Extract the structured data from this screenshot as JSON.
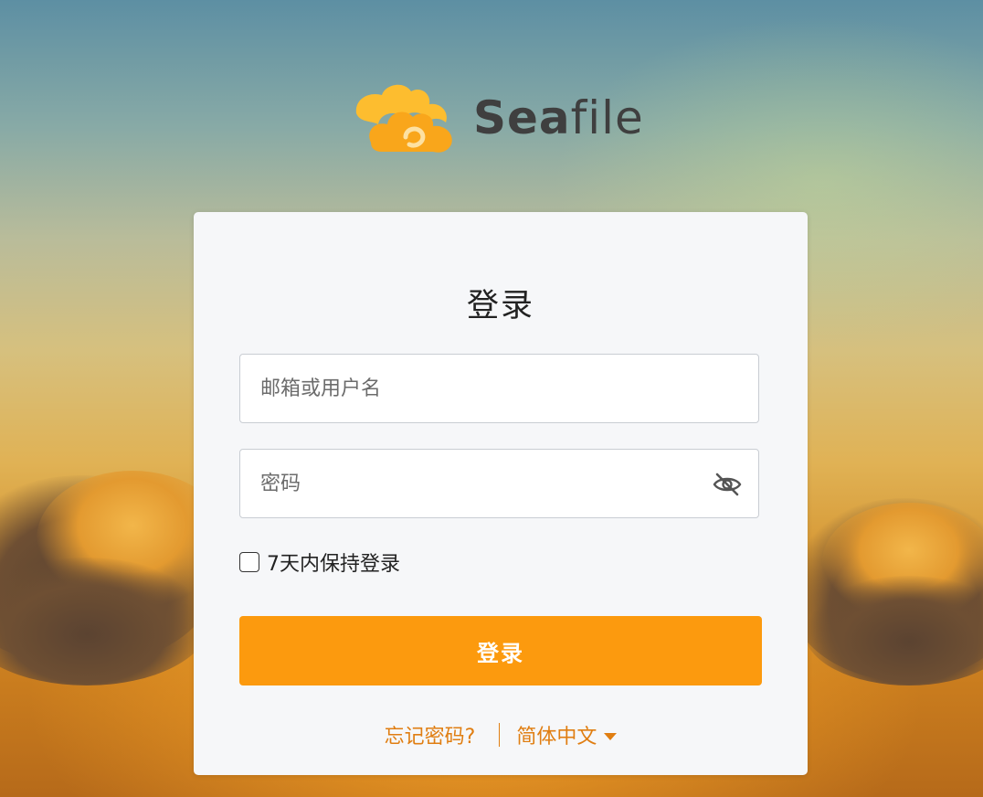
{
  "brand": {
    "name_bold": "Sea",
    "name_light": "file",
    "accent": "#fc9a0e",
    "logo_icon": "cloud-logo-icon"
  },
  "login": {
    "title": "登录",
    "username_placeholder": "邮箱或用户名",
    "username_value": "",
    "password_placeholder": "密码",
    "password_value": "",
    "password_toggle_icon": "eye-slash-icon",
    "remember_label": "7天内保持登录",
    "remember_checked": false,
    "submit_label": "登录"
  },
  "footer": {
    "forgot_password": "忘记密码?",
    "language": "简体中文",
    "language_icon": "caret-down-icon",
    "link_color": "#e07e12"
  }
}
